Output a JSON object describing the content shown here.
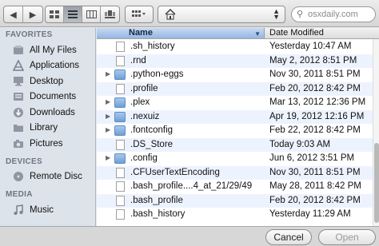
{
  "toolbar": {
    "back_icon": "chevron-left",
    "forward_icon": "chevron-right",
    "view_icons": [
      "icon-view",
      "list-view",
      "column-view",
      "coverflow-view"
    ],
    "active_view": "list-view",
    "arrange_icon": "arrange-grid",
    "path_icon": "home",
    "search_placeholder": "osxdaily.com"
  },
  "sidebar": {
    "sections": [
      {
        "title": "FAVORITES",
        "items": [
          {
            "label": "All My Files",
            "icon": "all-files"
          },
          {
            "label": "Applications",
            "icon": "applications"
          },
          {
            "label": "Desktop",
            "icon": "desktop"
          },
          {
            "label": "Documents",
            "icon": "documents"
          },
          {
            "label": "Downloads",
            "icon": "downloads"
          },
          {
            "label": "Library",
            "icon": "folder"
          },
          {
            "label": "Pictures",
            "icon": "camera"
          }
        ]
      },
      {
        "title": "DEVICES",
        "items": [
          {
            "label": "Remote Disc",
            "icon": "disc"
          }
        ]
      },
      {
        "title": "MEDIA",
        "items": [
          {
            "label": "Music",
            "icon": "music"
          }
        ]
      }
    ]
  },
  "filelist": {
    "columns": {
      "name": "Name",
      "date": "Date Modified"
    },
    "rows": [
      {
        "name": ".sh_history",
        "date": "Yesterday 10:47 AM",
        "kind": "file",
        "expandable": false
      },
      {
        "name": ".rnd",
        "date": "May 2, 2012 8:51 PM",
        "kind": "file",
        "expandable": false
      },
      {
        "name": ".python-eggs",
        "date": "Nov 30, 2011 8:51 PM",
        "kind": "folder",
        "expandable": true
      },
      {
        "name": ".profile",
        "date": "Feb 20, 2012 8:42 PM",
        "kind": "file",
        "expandable": false
      },
      {
        "name": ".plex",
        "date": "Mar 13, 2012 12:36 PM",
        "kind": "folder",
        "expandable": true
      },
      {
        "name": ".nexuiz",
        "date": "Apr 19, 2012 12:16 PM",
        "kind": "folder",
        "expandable": true
      },
      {
        "name": ".fontconfig",
        "date": "Feb 22, 2012 8:42 PM",
        "kind": "folder",
        "expandable": true
      },
      {
        "name": ".DS_Store",
        "date": "Today 9:03 AM",
        "kind": "file",
        "expandable": false
      },
      {
        "name": ".config",
        "date": "Jun 6, 2012 3:51 PM",
        "kind": "folder",
        "expandable": true
      },
      {
        "name": ".CFUserTextEncoding",
        "date": "Nov 30, 2011 8:51 PM",
        "kind": "file",
        "expandable": false
      },
      {
        "name": ".bash_profile....4_at_21/29/49",
        "date": "May 28, 2011 8:42 PM",
        "kind": "file",
        "expandable": false
      },
      {
        "name": ".bash_profile",
        "date": "Feb 20, 2012 8:42 PM",
        "kind": "file",
        "expandable": false
      },
      {
        "name": ".bash_history",
        "date": "Yesterday 11:29 AM",
        "kind": "file",
        "expandable": false
      }
    ]
  },
  "footer": {
    "cancel_label": "Cancel",
    "open_label": "Open"
  }
}
